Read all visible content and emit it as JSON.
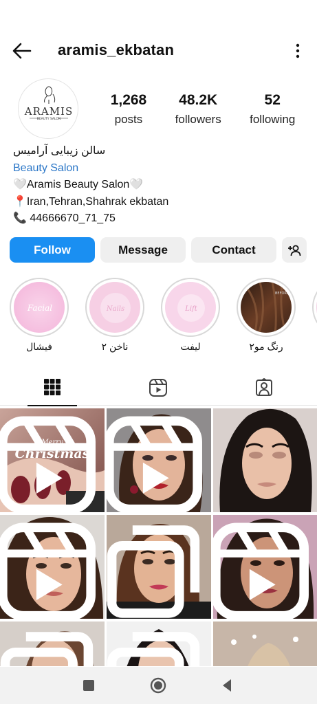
{
  "header": {
    "username": "aramis_ekbatan"
  },
  "avatar": {
    "brand_text": "ARAMIS",
    "sub_text": "BEAUTY SALON"
  },
  "stats": [
    {
      "value": "1,268",
      "label": "posts"
    },
    {
      "value": "48.2K",
      "label": "followers"
    },
    {
      "value": "52",
      "label": "following"
    }
  ],
  "bio": {
    "name_fa": "سالن زیبایی آرامیس",
    "category": "Beauty Salon",
    "line1": "🤍Aramis Beauty Salon🤍",
    "line2": "📍Iran,Tehran,Shahrak ekbatan",
    "line3": "📞  44666670_71_75"
  },
  "actions": {
    "follow": "Follow",
    "message": "Message",
    "contact": "Contact"
  },
  "highlights": [
    {
      "label": "فیشال",
      "cover_text": "Facial",
      "icon": "facial-highlight"
    },
    {
      "label": "ناخن ۲",
      "cover_text": "Nails",
      "icon": "nails-highlight"
    },
    {
      "label": "لیفت",
      "cover_text": "Lift",
      "icon": "lift-highlight"
    },
    {
      "label": "رنگ مو۲",
      "cover_text": "BEFORE",
      "icon": "hair-color-highlight"
    }
  ],
  "tabs": [
    "grid-icon",
    "reels-icon",
    "tagged-icon"
  ],
  "posts": [
    {
      "type": "reel",
      "overlay_text_1": "Merry",
      "overlay_text_2": "Christmas"
    },
    {
      "type": "reel"
    },
    {
      "type": "none"
    },
    {
      "type": "reel"
    },
    {
      "type": "carousel"
    },
    {
      "type": "reel"
    },
    {
      "type": "carousel"
    },
    {
      "type": "carousel"
    },
    {
      "type": "none"
    }
  ],
  "colors": {
    "follow_button": "#1a8ff2",
    "category_link": "#2a76c7",
    "button_bg": "#efefef"
  }
}
